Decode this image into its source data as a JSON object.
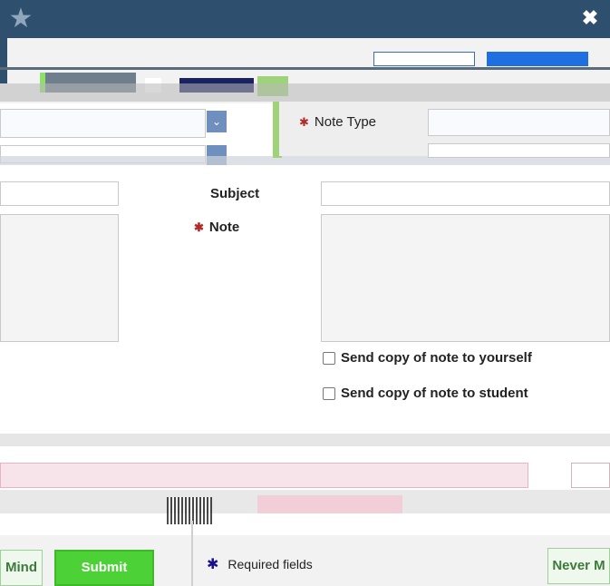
{
  "window": {
    "logo_icon": "star-logo-icon",
    "close_icon": "close-x-icon",
    "close_glyph": "✖"
  },
  "form": {
    "note_type_label": "Note Type",
    "subject_label": "Subject",
    "note_label": "Note",
    "required_mark": "✱",
    "send_self_label": "Send copy of note to yourself",
    "send_student_label": "Send copy of note to student"
  },
  "footer": {
    "remind_partial": "Mind",
    "submit_label": "Submit",
    "required_fields_label": "Required fields",
    "never_partial": "Never M"
  },
  "colors": {
    "titlebar": "#2f4f6e",
    "accent_green": "#4cd137",
    "required_red": "#b12a2a",
    "required_blue": "#1a0f8a"
  }
}
